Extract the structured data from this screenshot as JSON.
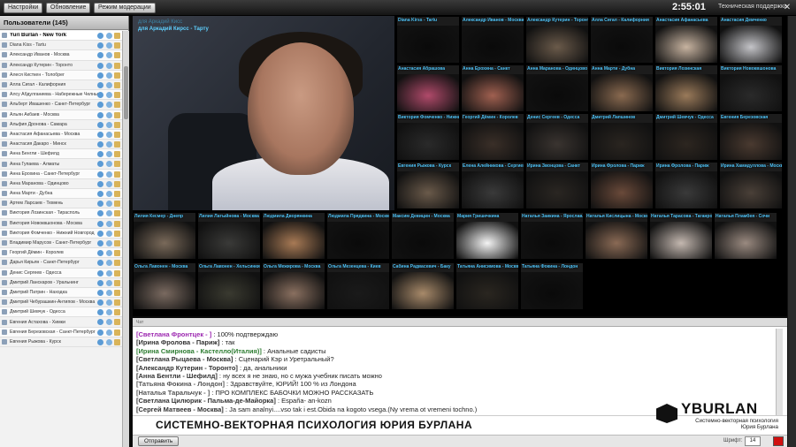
{
  "topbar": {
    "buttons": [
      "Настройки",
      "Обновление",
      "Режим модерации"
    ],
    "clock": "2:55:01",
    "support": "Техническая поддержка",
    "close_glyph": "✕"
  },
  "users": {
    "header": "Пользователи (145)",
    "list": [
      "Yuri Burlan - New York",
      "Diana Kiss - Tartu",
      "Александр Иванов - Москва",
      "Александр Кутерин - Торонто",
      "Алеся Кисткен - Толобрег",
      "Алла Сигал - Калифорния",
      "Алсу Абдулганиева - Набережные Челны",
      "Альберт Ивашенко - Санкт-Петербург",
      "Альян Акбаев - Москва",
      "Альфия Дронова - Самара",
      "Анастасия Афанасьева - Москва",
      "Анастасия Дакаро - Минск",
      "Анна Бенгли - Шефилд",
      "Анна Гупаева - Алматы",
      "Анна Ерохина - Санкт-Петербург",
      "Анна Маранова - Одинцово",
      "Анна Марти - Дубна",
      "Артем Ларсаев - Тюмень",
      "Виктория Лозинская - Тирасполь",
      "Виктория Новоквшонова - Москва",
      "Виктория Фомченко - Нижний Новгород",
      "Владимир Марусов - Санкт-Петербург",
      "Георгий Дёмин - Королев",
      "Дарья Кирьян - Санкт-Петербург",
      "Денис Сергеев - Одесса",
      "Дмитрий Ланскаров - Уральнинг",
      "Дмитрий Патрин - Находка",
      "Дмитрий Чебурашкин-Антипов - Москва",
      "Дмитрий Шевчук - Одесса",
      "Евгения Астахова - Химки",
      "Евгения Березовская - Санкт-Петербург",
      "Евгения Рыжова - Курск"
    ]
  },
  "main_video": {
    "label_top": "для Аркадий Кисс",
    "label": "для Аркадий Кирсс - Тарту"
  },
  "tiles": [
    {
      "name": "Diana Kirss - Tartu",
      "tone": "#0a0a0a"
    },
    {
      "name": "Александр Иванов - Москва",
      "tone": "#0a0a0a"
    },
    {
      "name": "Александр Кутерин - Торонто",
      "tone": "#6a5a4a"
    },
    {
      "name": "Алла Сигал - Калифорния",
      "tone": "#0a0a0a"
    },
    {
      "name": "Анастасия Афанасьева",
      "tone": "#c7b3a0"
    },
    {
      "name": "Анастасия Демченко",
      "tone": "#c4c4c8"
    },
    {
      "name": "Анастасия Абрашова",
      "tone": "#b04a6a"
    },
    {
      "name": "Анна Ерохина - Санкт",
      "tone": "#a06050"
    },
    {
      "name": "Анна Маранова - Одинцово",
      "tone": "#0a0a0a"
    },
    {
      "name": "Анна Марти - Дубна",
      "tone": "#8a6a50"
    },
    {
      "name": "Виктория Лозинская",
      "tone": "#9a7a5a"
    },
    {
      "name": "Виктория Новоквшонова",
      "tone": "#2a2a2a"
    },
    {
      "name": "Виктория Фомченко - Нижний",
      "tone": "#2a2a2a"
    },
    {
      "name": "Георгий Дёмин - Королев",
      "tone": "#3a2f28"
    },
    {
      "name": "Денис Сергеев - Одесса",
      "tone": "#3a3430"
    },
    {
      "name": "Дмитрий Лапшинов",
      "tone": "#2a2520"
    },
    {
      "name": "Дмитрий Шевчук - Одесса",
      "tone": "#2d2620"
    },
    {
      "name": "Евгения Березовская",
      "tone": "#4a3a30"
    },
    {
      "name": "Евгения Рыжова - Курск",
      "tone": "#6a5a4a"
    },
    {
      "name": "Елена Алейникова - Сергиев",
      "tone": "#3a3a3a"
    },
    {
      "name": "Ирина Звонцова - Санкт",
      "tone": "#2a2622"
    },
    {
      "name": "Ирина Фролова - Париж",
      "tone": "#6a4a3a"
    },
    {
      "name": "Ирина Фролова - Париж",
      "tone": "#3a3a3a"
    },
    {
      "name": "Ирина Хамидуллова - Москва",
      "tone": "#4a4038"
    },
    {
      "name": "Лилия Кесмер - Днепр",
      "tone": "#7a6a5a"
    },
    {
      "name": "Лилия Латыйнова - Москва",
      "tone": "#3a3a38"
    },
    {
      "name": "Людмила Дворянкина",
      "tone": "#a87a55"
    },
    {
      "name": "Людмила Прядкина - Москва",
      "tone": "#0a0a0a"
    },
    {
      "name": "Максим Девицин - Москва",
      "tone": "#0a0a0a"
    },
    {
      "name": "Мария Гришечкина",
      "tone": "#f4f4f4"
    },
    {
      "name": "Наталья Заикина - Ярославль",
      "tone": "#0a0a0a"
    },
    {
      "name": "Наталья Кислицына - Москва",
      "tone": "#8a6a55"
    },
    {
      "name": "Наталья Тарасова - Таганрог",
      "tone": "#c4b8b0"
    },
    {
      "name": "Наталья Пламбея - Сочи",
      "tone": "#9a8a80"
    },
    {
      "name": "Ольга Лавонен - Москва",
      "tone": "#7a6a60"
    },
    {
      "name": "Ольга Лавонен - Хельсинки",
      "tone": "#3a3a30"
    },
    {
      "name": "Ольга Межирова - Москва",
      "tone": "#8a7060"
    },
    {
      "name": "Ольга Мезенцева - Киев",
      "tone": "#1a1a1a"
    },
    {
      "name": "Сабина Радвасевич - Баку",
      "tone": "#a88a6a"
    },
    {
      "name": "Татьяна Анисимова - Москва",
      "tone": "#2a2620"
    },
    {
      "name": "Татьяна Фокина - Лондон",
      "tone": "#0a0a0a"
    }
  ],
  "chat": {
    "bar_label": "Чат",
    "lines": [
      {
        "author": "[Светлана Фронтцек - ]",
        "text": " : 100% подтверждаю",
        "color": "#9c27b0"
      },
      {
        "author": "[Ирина Фролова - Париж]",
        "text": " : так",
        "color": "#333333"
      },
      {
        "author": "[Ирина Смирнова - Кастелло(Италия)]",
        "text": " : Анальные садисты",
        "color": "#2e7d32"
      },
      {
        "author": "[Светлана Рыцаева - Москва]",
        "text": " : Сценарий Кэр и Уретральный?",
        "color": "#333333"
      },
      {
        "author": "[Александр Кутерин - Торонто]",
        "text": " : да, анальники",
        "color": "#333333"
      },
      {
        "author": "[Анна Бентли - Шефилд]",
        "text": " : ну всех я не знаю, но с мужа учебник писать можно",
        "color": "#333333"
      },
      {
        "author": "[Татьяна Фокина - Лондон]",
        "text": " : Здравствуйте, ЮРИЙ! 100 % из Лондона",
        "color": "#555555"
      },
      {
        "author": "[Наталья Таральчук - ]",
        "text": " : ПРО КОМПЛЕКС БАБОЧКИ МОЖНО РАССКАЗАТЬ",
        "color": "#555555"
      },
      {
        "author": "[Светлана Цилюрик - Пальма-де-Майорка]",
        "text": " : España- an-kozn",
        "color": "#333333"
      },
      {
        "author": "[Сергей Матвеев - Москва]",
        "text": " : Ja sam analnyi....vso tak i est.Obida na kogoto vsega.(Ny vrema ot vremeni tochno.)",
        "color": "#333333"
      }
    ]
  },
  "brand": {
    "title": "СИСТЕМНО-ВЕКТОРНАЯ ПСИХОЛОГИЯ ЮРИЯ БУРЛАНА",
    "logo_text": "YBURLAN",
    "logo_sub": "Системно-векторная психология Юрия Бурлана"
  },
  "send": {
    "button": "Отправить",
    "font_label": "Шрифт:",
    "font_size": "14"
  }
}
